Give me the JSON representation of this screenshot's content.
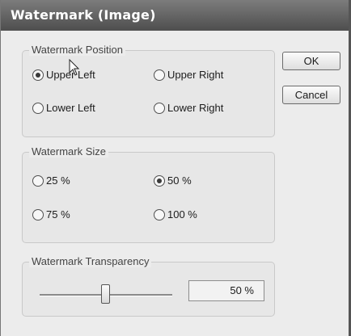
{
  "window": {
    "title": "Watermark (Image)"
  },
  "position": {
    "legend": "Watermark Position",
    "options": [
      {
        "label": "Upper Left",
        "selected": true
      },
      {
        "label": "Upper Right",
        "selected": false
      },
      {
        "label": "Lower Left",
        "selected": false
      },
      {
        "label": "Lower Right",
        "selected": false
      }
    ]
  },
  "size": {
    "legend": "Watermark Size",
    "options": [
      {
        "label": "25 %",
        "selected": false
      },
      {
        "label": "50 %",
        "selected": true
      },
      {
        "label": "75 %",
        "selected": false
      },
      {
        "label": "100 %",
        "selected": false
      }
    ]
  },
  "transparency": {
    "legend": "Watermark Transparency",
    "value": 50,
    "value_label": "50 %"
  },
  "buttons": {
    "ok": "OK",
    "cancel": "Cancel"
  }
}
